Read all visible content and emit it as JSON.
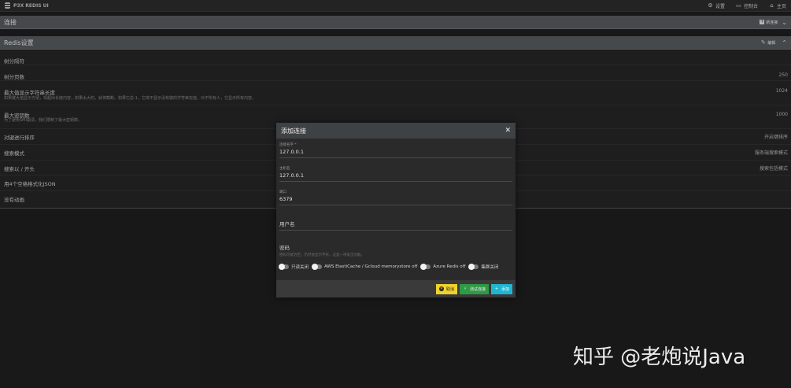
{
  "app": {
    "brand": "P3X REDIS UI"
  },
  "topnav": [
    {
      "label": "设置",
      "icon": "gear-icon"
    },
    {
      "label": "控制台",
      "icon": "console-icon"
    },
    {
      "label": "主页",
      "icon": "home-icon"
    }
  ],
  "connection_bar": {
    "title": "连接",
    "new_button": "新连接"
  },
  "settings_bar": {
    "title": "Redis设置",
    "edit_button": "编辑"
  },
  "settings_rows": [
    {
      "label": "树分隔符",
      "sub": "",
      "value": ""
    },
    {
      "label": "树分页数",
      "sub": "",
      "value": "250"
    },
    {
      "label": "最大值显示字符串长度",
      "sub": "如果键大值显示方便，现超出长度内容，如果太大的，就将截断。如果它总-1，它将不显示没有键的字符串完值，对于所有人，它显示所有内容。",
      "value": "1024"
    },
    {
      "label": "最大密钥数",
      "sub": "为了避免SMI崩溃，我们限制了最大密钥数。",
      "value": "1000"
    },
    {
      "label": "对键进行排序",
      "sub": "",
      "value": "开启键排序"
    },
    {
      "label": "搜索模式",
      "sub": "",
      "value": "服务端搜索模式"
    },
    {
      "label": "搜索以 / 开头",
      "sub": "",
      "value": "搜索包括模式"
    },
    {
      "label": "用4个空格格式化JSON",
      "sub": "",
      "value": ""
    },
    {
      "label": "没有动画",
      "sub": "",
      "value": ""
    }
  ],
  "modal": {
    "title": "添加连接",
    "fields": [
      {
        "label": "连接名字 *",
        "value": "127.0.0.1"
      },
      {
        "label": "主机名",
        "value": "127.0.0.1"
      },
      {
        "label": "端口",
        "value": "6379"
      },
      {
        "label": "用户名",
        "value": ""
      },
      {
        "label": "密码",
        "placeholder": "密码可能为空，仍然会显示字符，这是一项安全功能。"
      }
    ],
    "toggles": [
      "只读关闭",
      "AWS ElastiCache / Gcloud memorystore off",
      "Azure Redis off",
      "集群关闭"
    ],
    "buttons": {
      "cancel": "取消",
      "test": "测试连接",
      "add": "添加"
    }
  },
  "watermark": "知乎 @老炮说Java",
  "colors": {
    "cancel": "#f0d22c",
    "test": "#2f9a45",
    "add": "#1eb6d2"
  }
}
